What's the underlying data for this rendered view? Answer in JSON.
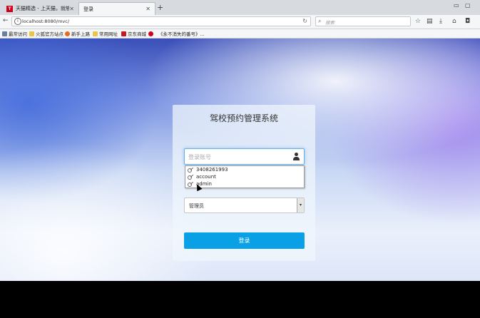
{
  "browser": {
    "tabs": [
      {
        "title": "天猫精选 - 上天猫，就够了",
        "icon": "tmall-favicon-icon",
        "active": false
      },
      {
        "title": "登录",
        "icon": "",
        "active": true
      }
    ],
    "new_tab": "+",
    "url": "localhost:8080/mvc/",
    "search_placeholder": "搜索",
    "bookmarks": [
      {
        "label": "最常访问",
        "icon": "bookmarks-list-icon"
      },
      {
        "label": "火狐官方站点",
        "icon": "folder-icon"
      },
      {
        "label": "新手上路",
        "icon": "firefox-icon"
      },
      {
        "label": "常用网址",
        "icon": "folder-icon"
      },
      {
        "label": "京东商城",
        "icon": "jd-icon"
      },
      {
        "label": "《永不消失的番号》...",
        "icon": "video-icon"
      }
    ]
  },
  "login": {
    "title": "驾校预约管理系统",
    "account_placeholder": "登录账号",
    "autocomplete": [
      "3408261993",
      "account",
      "admin"
    ],
    "role_value": "管理员",
    "submit_label": "登录"
  }
}
